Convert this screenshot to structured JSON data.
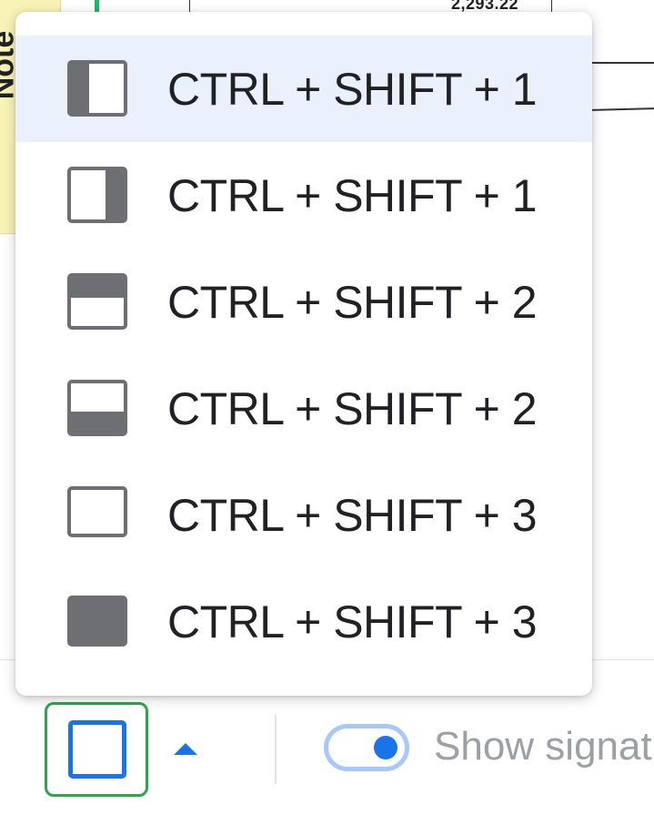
{
  "document": {
    "sticky_note_label": "Note",
    "visible_amount": "2,293.22"
  },
  "layout_menu": {
    "items": [
      {
        "icon": "panel-left-icon",
        "shortcut": "CTRL + SHIFT + 1",
        "selected": true
      },
      {
        "icon": "panel-right-icon",
        "shortcut": "CTRL + SHIFT + 1",
        "selected": false
      },
      {
        "icon": "panel-top-icon",
        "shortcut": "CTRL + SHIFT + 2",
        "selected": false
      },
      {
        "icon": "panel-bottom-icon",
        "shortcut": "CTRL + SHIFT + 2",
        "selected": false
      },
      {
        "icon": "panel-empty-icon",
        "shortcut": "CTRL + SHIFT + 3",
        "selected": false
      },
      {
        "icon": "panel-full-icon",
        "shortcut": "CTRL + SHIFT + 3",
        "selected": false
      }
    ]
  },
  "toolbar": {
    "layout_button_icon": "panel-left-icon",
    "toggle_label": "Show signat",
    "toggle_on": true
  },
  "colors": {
    "accent": "#1a73e8",
    "selected_row": "#eaf1fd",
    "icon_gray": "#6e6f72",
    "focus_ring": "#2ea44f",
    "sticky_note": "#faf3b7"
  }
}
